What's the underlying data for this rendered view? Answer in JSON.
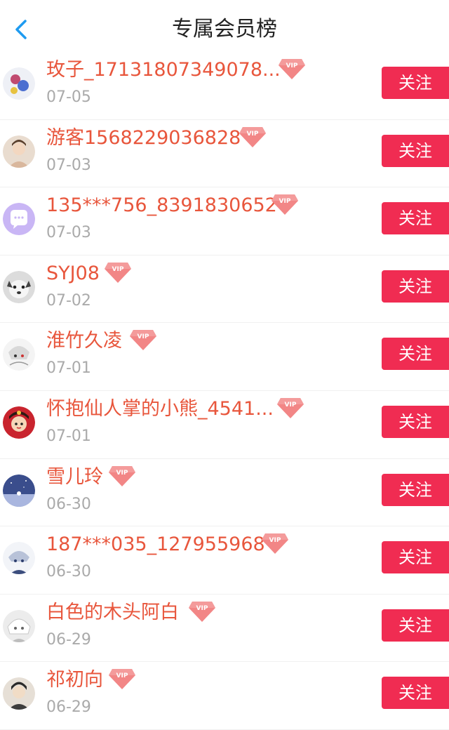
{
  "header": {
    "title": "专属会员榜"
  },
  "members": [
    {
      "name": "玫子_17131807349078...",
      "date": "07-05",
      "button": "关注"
    },
    {
      "name": "游客1568229036828",
      "date": "07-03",
      "button": "关注"
    },
    {
      "name": "135***756_8391830652",
      "date": "07-03",
      "button": "关注"
    },
    {
      "name": "SYJ08",
      "date": "07-02",
      "button": "关注"
    },
    {
      "name": "淮竹久凌",
      "date": "07-01",
      "button": "关注"
    },
    {
      "name": "怀抱仙人掌的小熊_4541...",
      "date": "07-01",
      "button": "关注"
    },
    {
      "name": "雪儿玲",
      "date": "06-30",
      "button": "关注"
    },
    {
      "name": "187***035_127955968",
      "date": "06-30",
      "button": "关注"
    },
    {
      "name": "白色的木头阿白",
      "date": "06-29",
      "button": "关注"
    },
    {
      "name": "祁初向",
      "date": "06-29",
      "button": "关注"
    }
  ],
  "vip_badge": "VIP",
  "colors": {
    "accent": "#f02c52",
    "name": "#e8563c",
    "date": "#aaaaaa",
    "back_arrow": "#1e9bf0"
  }
}
